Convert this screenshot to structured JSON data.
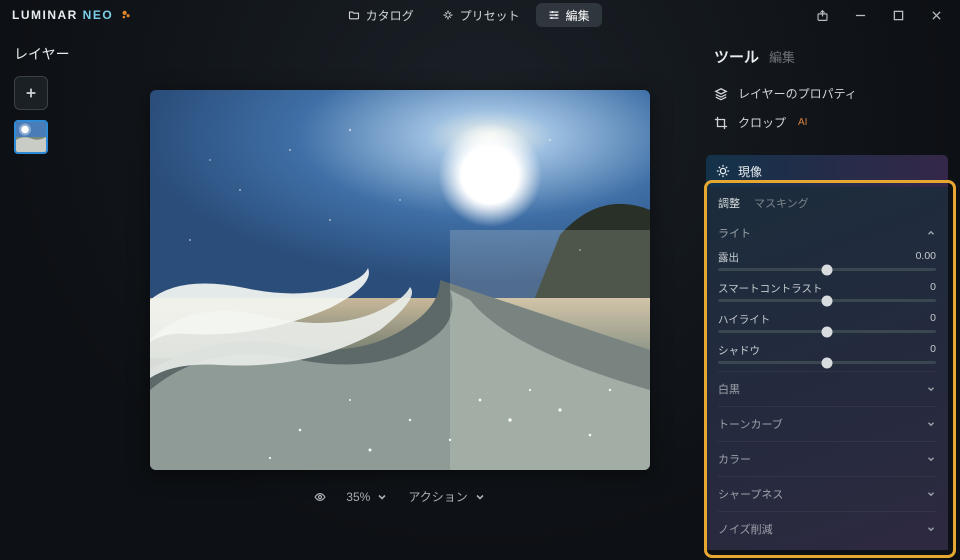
{
  "app_name_main": "LUMINAR",
  "app_name_sub": "NEO",
  "nav": {
    "catalog": "カタログ",
    "presets": "プリセット",
    "edit": "編集"
  },
  "left_panel": {
    "title": "レイヤー"
  },
  "bottom": {
    "zoom": "35%",
    "action": "アクション"
  },
  "right": {
    "tools": "ツール",
    "edit": "編集",
    "layer_props": "レイヤーのプロパティ",
    "crop": "クロップ",
    "ai": "AI"
  },
  "develop": {
    "title": "現像",
    "tab_adjust": "調整",
    "tab_masking": "マスキング",
    "section_light": "ライト",
    "sliders": {
      "exposure_label": "露出",
      "exposure_value": "0.00",
      "contrast_label": "スマートコントラスト",
      "contrast_value": "0",
      "highlight_label": "ハイライト",
      "highlight_value": "0",
      "shadow_label": "シャドウ",
      "shadow_value": "0"
    },
    "collapsed": {
      "bw": "白黒",
      "curve": "トーンカーブ",
      "color": "カラー",
      "sharp": "シャープネス",
      "noise": "ノイズ削減"
    }
  }
}
